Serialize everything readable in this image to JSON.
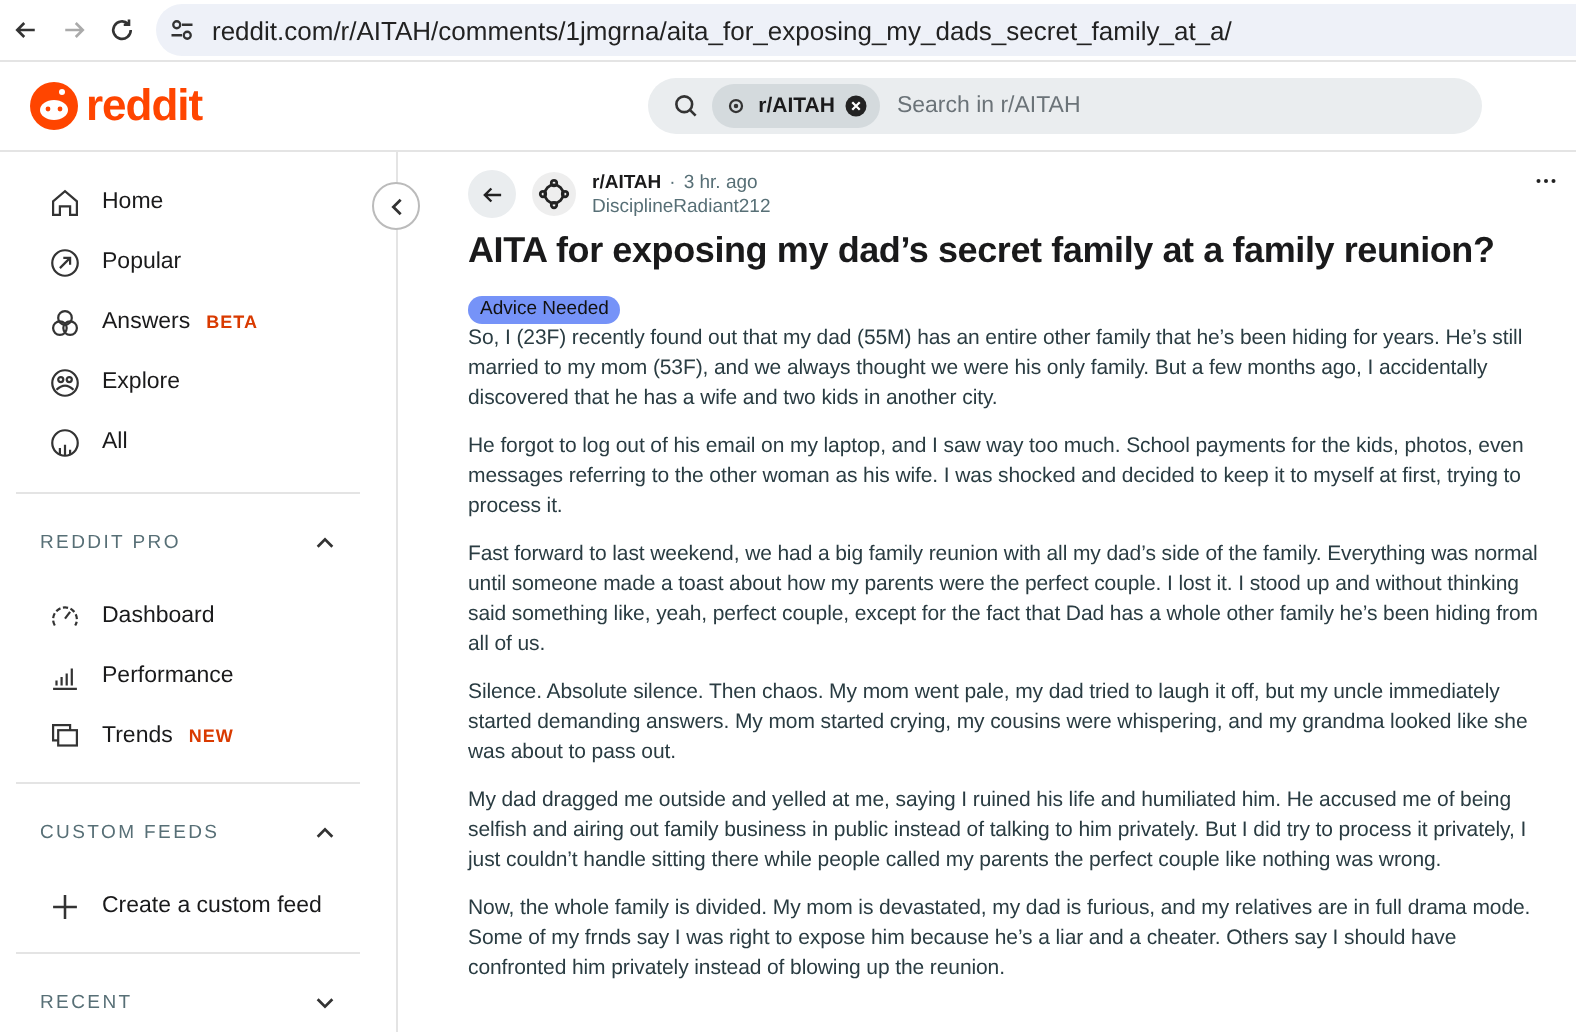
{
  "browser": {
    "url": "reddit.com/r/AITAH/comments/1jmgrna/aita_for_exposing_my_dads_secret_family_at_a/"
  },
  "header": {
    "logo": "reddit",
    "search": {
      "chip": "r/AITAH",
      "placeholder": "Search in r/AITAH"
    }
  },
  "sidebar": {
    "nav": [
      {
        "label": "Home"
      },
      {
        "label": "Popular"
      },
      {
        "label": "Answers",
        "badge": "BETA"
      },
      {
        "label": "Explore"
      },
      {
        "label": "All"
      }
    ],
    "sections": [
      {
        "title": "REDDIT PRO",
        "expanded": true,
        "items": [
          {
            "label": "Dashboard"
          },
          {
            "label": "Performance"
          },
          {
            "label": "Trends",
            "badge": "NEW"
          }
        ]
      },
      {
        "title": "CUSTOM FEEDS",
        "expanded": true,
        "items": [
          {
            "label": "Create a custom feed"
          }
        ]
      },
      {
        "title": "RECENT",
        "expanded": false
      }
    ]
  },
  "post": {
    "subreddit": "r/AITAH",
    "separator": "·",
    "time": "3 hr. ago",
    "author": "DisciplineRadiant212",
    "title": "AITA for exposing my dad’s secret family at a family reunion?",
    "flair": "Advice Needed",
    "paragraphs": [
      "So, I (23F) recently found out that my dad (55M) has an entire other family that he’s been hiding for years. He’s still married to my mom (53F), and we always thought we were his only family. But a few months ago, I accidentally discovered that he has a wife and two kids in another city.",
      "He forgot to log out of his email on my laptop, and I saw way too much. School payments for the kids, photos, even messages referring to the other woman as his wife. I was shocked and decided to keep it to myself at first, trying to process it.",
      "Fast forward to last weekend, we had a big family reunion with all my dad’s side of the family. Everything was normal until someone made a toast about how my parents were the perfect couple. I lost it. I stood up and without thinking said something like, yeah, perfect couple, except for the fact that Dad has a whole other family he’s been hiding from all of us.",
      "Silence. Absolute silence. Then chaos. My mom went pale, my dad tried to laugh it off, but my uncle immediately started demanding answers. My mom started crying, my cousins were whispering, and my grandma looked like she was about to pass out.",
      "My dad dragged me outside and yelled at me, saying I ruined his life and humiliated him. He accused me of being selfish and airing out family business in public instead of talking to him privately. But I did try to process it privately, I just couldn’t handle sitting there while people called my parents the perfect couple like nothing was wrong.",
      "Now, the whole family is divided. My mom is devastated, my dad is furious, and my relatives are in full drama mode. Some of my frnds say I was right to expose him because he’s a liar and a cheater. Others say I should have confronted him privately instead of blowing up the reunion."
    ]
  }
}
